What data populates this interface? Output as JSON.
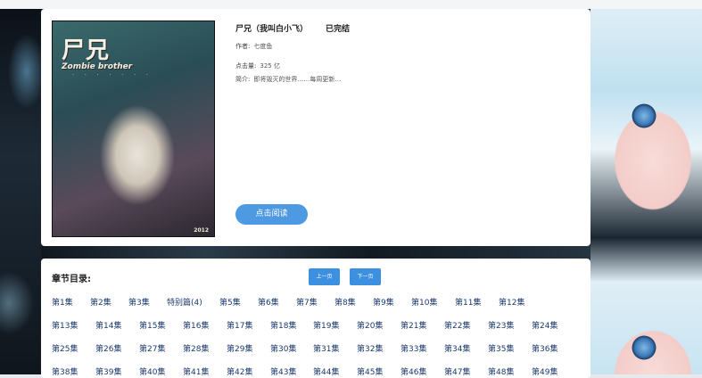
{
  "comic": {
    "title": "尸兄（我叫白小飞）",
    "status": "已完结",
    "author_label": "作者:",
    "author": "七度鱼",
    "views_label": "点击量:",
    "views": "325 亿",
    "summary_label": "简介:",
    "summary": "即将毁灭的世界……每周更新…",
    "read_button": "点击阅读",
    "cover": {
      "title_text": "尸兄",
      "subtitle_text": "Zombie brother",
      "dots_text": "· · · · · · ·",
      "year_text": "2012"
    }
  },
  "toc": {
    "title": "章节目录:",
    "prev_label": "上一页",
    "next_label": "下一页",
    "rows": [
      [
        "第1集",
        "第2集",
        "第3集",
        "特别篇(4)",
        "第5集",
        "第6集",
        "第7集",
        "第8集",
        "第9集",
        "第10集",
        "第11集",
        "第12集"
      ],
      [
        "第13集",
        "第14集",
        "第15集",
        "第16集",
        "第17集",
        "第18集",
        "第19集",
        "第20集",
        "第21集",
        "第22集",
        "第23集",
        "第24集"
      ],
      [
        "第25集",
        "第26集",
        "第27集",
        "第28集",
        "第29集",
        "第30集",
        "第31集",
        "第32集",
        "第33集",
        "第34集",
        "第35集",
        "第36集"
      ],
      [
        "第38集",
        "第39集",
        "第40集",
        "第41集",
        "第42集",
        "第43集",
        "第44集",
        "第45集",
        "第46集",
        "第47集",
        "第48集",
        "第49集"
      ]
    ]
  }
}
